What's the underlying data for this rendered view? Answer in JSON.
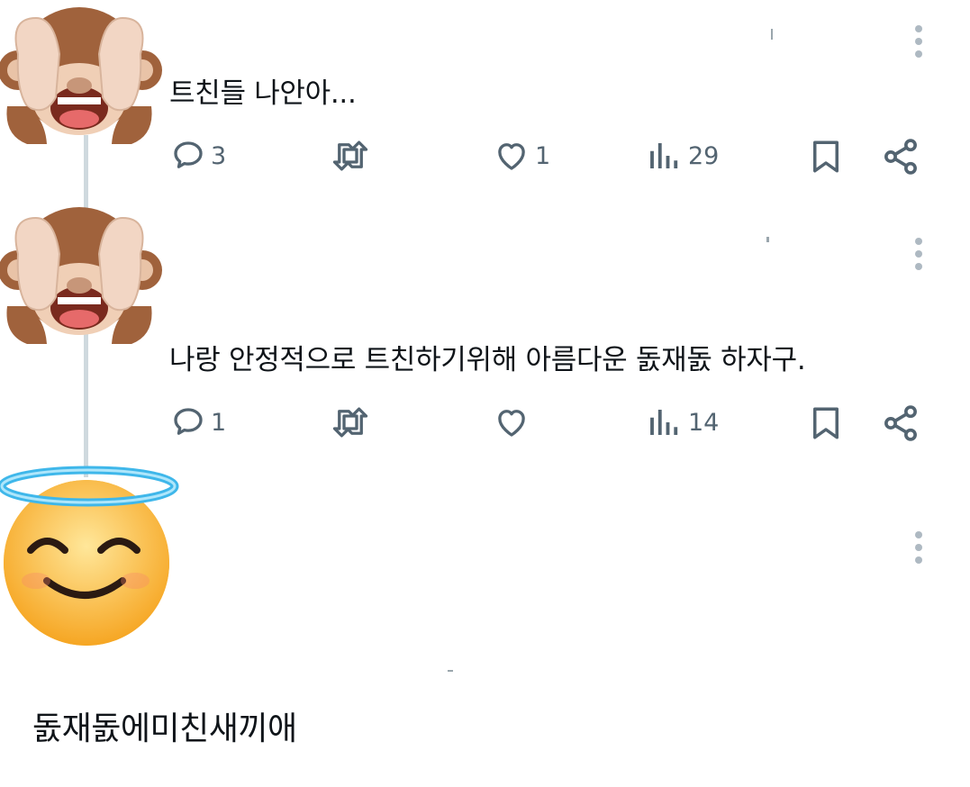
{
  "tweets": [
    {
      "text": "트친들 나안아...",
      "replies": "3",
      "retweets": "",
      "likes": "1",
      "views": "29"
    },
    {
      "text": "나랑 안정적으로 트친하기위해 아름다운 돐재돐 하자구.",
      "replies": "1",
      "retweets": "",
      "likes": "",
      "views": "14"
    }
  ],
  "reply": {
    "text": "돐재돐에미친새끼애"
  },
  "icons": {
    "avatar_1": "see-no-evil-monkey",
    "avatar_2": "see-no-evil-monkey",
    "avatar_3": "smiling-face-with-halo",
    "reply": "speech-bubble-icon",
    "retweet": "retweet-icon",
    "like": "heart-icon",
    "views": "bar-chart-icon",
    "bookmark": "bookmark-icon",
    "share": "share-icon",
    "more": "vertical-ellipsis-icon"
  },
  "colors": {
    "text": "#0f1419",
    "icon": "#536471",
    "thread_line": "#cfd9de"
  }
}
